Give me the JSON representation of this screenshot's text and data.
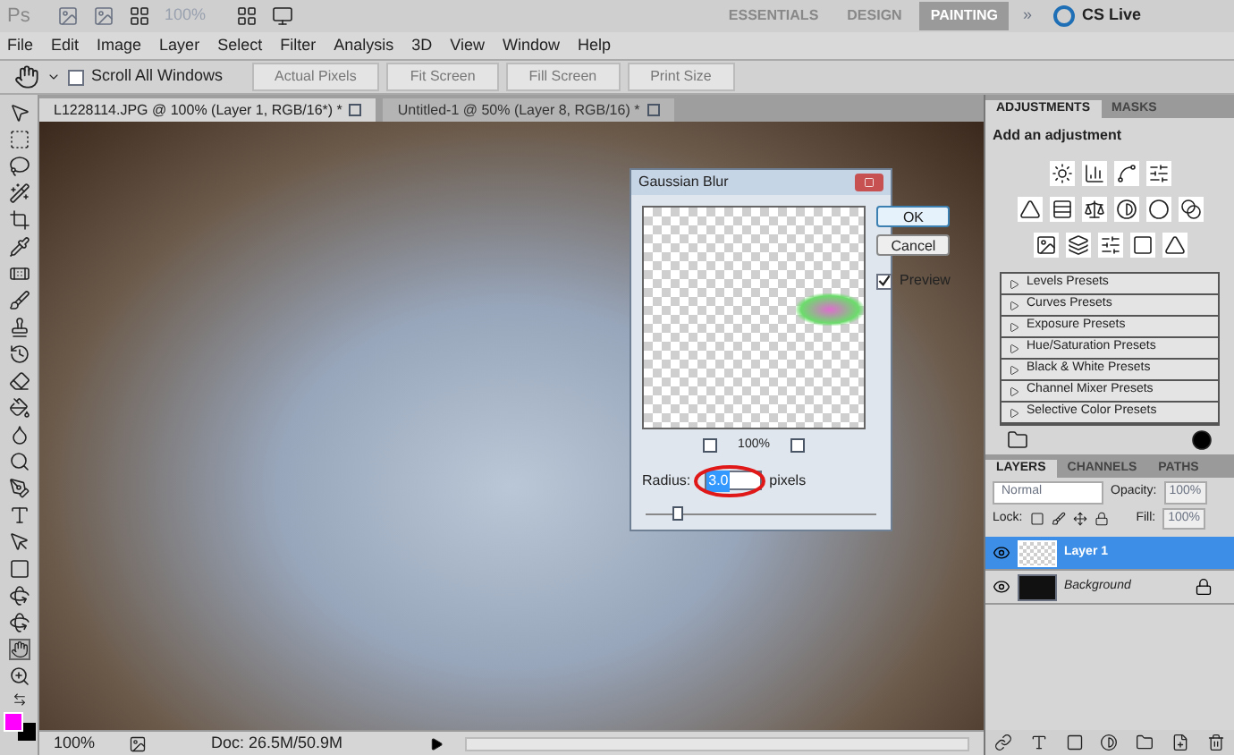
{
  "app_bar": {
    "logo": "Ps",
    "zoom": "100%",
    "workspaces": [
      {
        "label": "ESSENTIALS",
        "selected": false
      },
      {
        "label": "DESIGN",
        "selected": false
      },
      {
        "label": "PAINTING",
        "selected": true
      }
    ],
    "more": "»",
    "cs_live": "CS Live"
  },
  "menu": [
    "File",
    "Edit",
    "Image",
    "Layer",
    "Select",
    "Filter",
    "Analysis",
    "3D",
    "View",
    "Window",
    "Help"
  ],
  "options_bar": {
    "scroll_all_windows": {
      "label": "Scroll All Windows",
      "checked": false
    },
    "buttons": [
      "Actual Pixels",
      "Fit Screen",
      "Fill Screen",
      "Print Size"
    ]
  },
  "document_tabs": [
    {
      "label": "L1228114.JPG @ 100% (Layer 1, RGB/16*) *",
      "selected": true
    },
    {
      "label": "Untitled-1 @ 50% (Layer 8, RGB/16) *",
      "selected": false
    }
  ],
  "dialog": {
    "title": "Gaussian Blur",
    "zoom": "100%",
    "radius_label": "Radius:",
    "radius_value": "3.0",
    "unit": "pixels",
    "level": 0.12,
    "buttons": [
      "OK",
      "Cancel"
    ],
    "preview": {
      "label": "Preview",
      "checked": true
    }
  },
  "adjustments_panel": {
    "tabs": [
      {
        "label": "ADJUSTMENTS",
        "selected": true
      },
      {
        "label": "MASKS",
        "selected": false
      }
    ],
    "heading": "Add an adjustment",
    "presets": [
      "Levels Presets",
      "Curves Presets",
      "Exposure Presets",
      "Hue/Saturation Presets",
      "Black & White Presets",
      "Channel Mixer Presets",
      "Selective Color Presets"
    ]
  },
  "layers_panel": {
    "tabs": [
      {
        "label": "LAYERS",
        "selected": true
      },
      {
        "label": "CHANNELS",
        "selected": false
      },
      {
        "label": "PATHS",
        "selected": false
      }
    ],
    "blend_mode": "Normal",
    "opacity_label": "Opacity:",
    "opacity": "100%",
    "lock_label": "Lock:",
    "fill_label": "Fill:",
    "fill": "100%",
    "layers": [
      {
        "name": "Layer 1",
        "selected": true,
        "visible": true
      },
      {
        "name": "Background",
        "selected": false,
        "visible": true
      }
    ]
  },
  "status_bar": {
    "zoom": "100%",
    "doc": "Doc: 26.5M/50.9M"
  }
}
